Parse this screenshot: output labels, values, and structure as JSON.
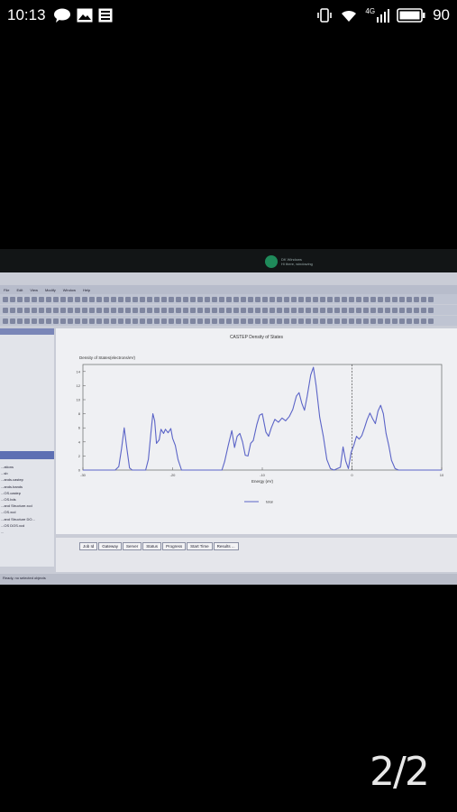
{
  "status_bar": {
    "time": "10:13",
    "network": "4G",
    "battery": "90",
    "icons": [
      "chat-bubble-icon",
      "image-icon",
      "grid-icon",
      "vibrate-icon",
      "wifi-icon",
      "signal-icon",
      "battery-icon"
    ]
  },
  "notification": {
    "lines": [
      "DK Windows",
      "Hi there, windowing"
    ]
  },
  "menu": {
    "items": [
      "File",
      "Edit",
      "View",
      "Modify",
      "Window",
      "Help"
    ]
  },
  "chart_data": {
    "type": "line",
    "title": "CASTEP Density of States",
    "ylabel": "Density of States(electrons/eV)",
    "xlabel": "Energy (eV)",
    "xlim": [
      -30,
      10
    ],
    "ylim": [
      0,
      15
    ],
    "x_ticks": [
      -30,
      -20,
      -10,
      0,
      10
    ],
    "y_ticks": [
      0,
      2,
      4,
      6,
      8,
      10,
      12,
      14
    ],
    "fermi_level": 0,
    "series": [
      {
        "name": "total",
        "points": [
          [
            -30,
            0
          ],
          [
            -26.4,
            0
          ],
          [
            -26,
            0.5
          ],
          [
            -25.7,
            3
          ],
          [
            -25.4,
            6
          ],
          [
            -25.1,
            3
          ],
          [
            -24.8,
            0.3
          ],
          [
            -24.5,
            0
          ],
          [
            -23,
            0
          ],
          [
            -22.7,
            1.5
          ],
          [
            -22.4,
            5.5
          ],
          [
            -22.2,
            8
          ],
          [
            -22,
            7
          ],
          [
            -21.8,
            3.8
          ],
          [
            -21.5,
            4.3
          ],
          [
            -21.3,
            5.8
          ],
          [
            -21,
            5.2
          ],
          [
            -20.8,
            5.8
          ],
          [
            -20.5,
            5.3
          ],
          [
            -20.2,
            5.9
          ],
          [
            -20,
            4.5
          ],
          [
            -19.7,
            3.5
          ],
          [
            -19.4,
            1.5
          ],
          [
            -19,
            0
          ],
          [
            -14.5,
            0
          ],
          [
            -14.2,
            1.2
          ],
          [
            -13.8,
            3.5
          ],
          [
            -13.4,
            5.6
          ],
          [
            -13.1,
            3.2
          ],
          [
            -12.8,
            4.8
          ],
          [
            -12.5,
            5.2
          ],
          [
            -12.2,
            4
          ],
          [
            -11.9,
            2.1
          ],
          [
            -11.6,
            2
          ],
          [
            -11.3,
            3.8
          ],
          [
            -11,
            4.2
          ],
          [
            -10.6,
            6.5
          ],
          [
            -10.3,
            7.8
          ],
          [
            -10,
            8
          ],
          [
            -9.6,
            5.4
          ],
          [
            -9.3,
            4.8
          ],
          [
            -9,
            6
          ],
          [
            -8.6,
            7.2
          ],
          [
            -8.2,
            6.8
          ],
          [
            -7.8,
            7.4
          ],
          [
            -7.4,
            7
          ],
          [
            -7,
            7.6
          ],
          [
            -6.6,
            8.6
          ],
          [
            -6.2,
            10.5
          ],
          [
            -5.9,
            11
          ],
          [
            -5.6,
            9.5
          ],
          [
            -5.3,
            8.5
          ],
          [
            -5,
            10.5
          ],
          [
            -4.6,
            13.5
          ],
          [
            -4.3,
            14.6
          ],
          [
            -4,
            12
          ],
          [
            -3.6,
            7.5
          ],
          [
            -3.2,
            4.8
          ],
          [
            -2.8,
            1.5
          ],
          [
            -2.4,
            0.2
          ],
          [
            -2,
            0
          ],
          [
            -1.3,
            0.4
          ],
          [
            -1,
            3.3
          ],
          [
            -0.7,
            1.3
          ],
          [
            -0.4,
            0.2
          ],
          [
            -0.1,
            2.5
          ],
          [
            0.2,
            3.5
          ],
          [
            0.5,
            4.8
          ],
          [
            0.8,
            4.4
          ],
          [
            1.1,
            4.9
          ],
          [
            1.4,
            6
          ],
          [
            1.7,
            7.2
          ],
          [
            2,
            8.1
          ],
          [
            2.3,
            7.3
          ],
          [
            2.6,
            6.6
          ],
          [
            2.9,
            8.4
          ],
          [
            3.2,
            9.2
          ],
          [
            3.5,
            8
          ],
          [
            3.8,
            5.2
          ],
          [
            4.1,
            3.5
          ],
          [
            4.4,
            1.4
          ],
          [
            4.8,
            0.2
          ],
          [
            5.2,
            0
          ],
          [
            10,
            0
          ]
        ]
      }
    ],
    "legend": {
      "position": "bottom-center"
    },
    "grid": false
  },
  "left_panel": {
    "items": [
      "...ations",
      "...sb",
      "...ands.castep",
      "...ands.bands",
      "...OS.castep",
      "...OS.bds",
      "...and Structure.xcd",
      "...OS.xcd",
      "...and Structure DO...",
      "...OS DOS.xcd",
      "..."
    ]
  },
  "jobs_table": {
    "columns": [
      "Job Id",
      "Gateway",
      "Server",
      "Status",
      "Progress",
      "Start Time",
      "Results ..."
    ]
  },
  "status_line": "Ready, no selected objects",
  "page_counter": "2/2"
}
